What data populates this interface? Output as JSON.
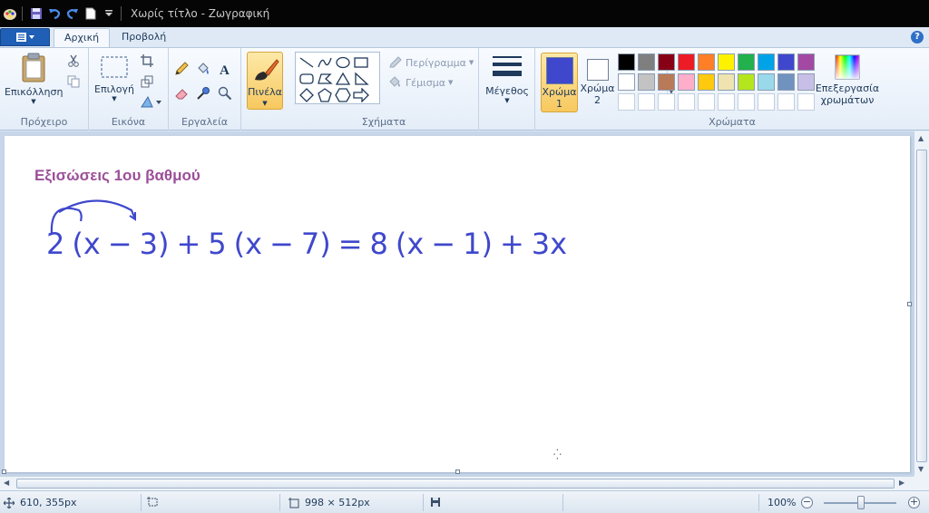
{
  "window": {
    "title": "Χωρίς τίτλο - Ζωγραφική"
  },
  "tabs": [
    {
      "label": "Αρχική",
      "active": true
    },
    {
      "label": "Προβολή",
      "active": false
    }
  ],
  "help_label": "?",
  "groups": {
    "clipboard": {
      "label": "Πρόχειρο",
      "paste_label": "Επικόλληση"
    },
    "image": {
      "label": "Εικόνα",
      "select_label": "Επιλογή"
    },
    "tools": {
      "label": "Εργαλεία"
    },
    "brushes": {
      "label": "Πινέλα"
    },
    "shapes": {
      "label": "Σχήματα",
      "outline_label": "Περίγραμμα",
      "fill_label": "Γέμισμα"
    },
    "size": {
      "label": "Μέγεθος"
    },
    "colors": {
      "label": "Χρώματα",
      "color1_label_a": "Χρώμα",
      "color1_label_b": "1",
      "color2_label_a": "Χρώμα",
      "color2_label_b": "2",
      "edit_label_a": "Επεξεργασία",
      "edit_label_b": "χρωμάτων",
      "color1_value": "#3f48cc",
      "color2_value": "#ffffff",
      "palette_row1": [
        "#000000",
        "#7f7f7f",
        "#880015",
        "#ed1c24",
        "#ff7f27",
        "#fff200",
        "#22b14c",
        "#00a2e8",
        "#3f48cc",
        "#a349a4"
      ],
      "palette_row2": [
        "#ffffff",
        "#c3c3c3",
        "#b97a57",
        "#ffaec9",
        "#ffc90e",
        "#efe4b0",
        "#b5e61d",
        "#99d9ea",
        "#7092be",
        "#c8bfe7"
      ]
    }
  },
  "canvas": {
    "title": "Εξισώσεις 1ου βαθμού",
    "equation_parts": [
      "2",
      "(x",
      "−",
      "3)",
      "+",
      "5",
      "(x",
      "−",
      "7)",
      "=",
      "8",
      "(x",
      "−",
      "1)",
      "+",
      "3x"
    ],
    "ink_color": "#3f48cc",
    "title_color": "#9b4f98"
  },
  "statusbar": {
    "cursor_pos": "610, 355px",
    "image_size": "998 × 512px",
    "zoom": "100%",
    "zoom_level": 1.0
  }
}
